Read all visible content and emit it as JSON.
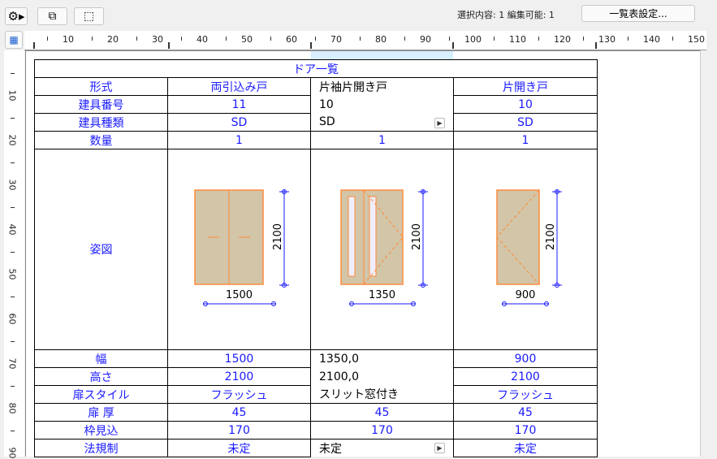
{
  "toolbar": {
    "status": "選択内容: 1  編集可能: 1",
    "settings_button": "一覧表設定..."
  },
  "ruler": {
    "h_labels": [
      "10",
      "20",
      "30",
      "40",
      "50",
      "60",
      "70",
      "80",
      "90",
      "100",
      "110",
      "120",
      "130",
      "140",
      "150"
    ],
    "v_labels": [
      "10",
      "20",
      "30",
      "40",
      "50",
      "60",
      "70",
      "80",
      "90"
    ]
  },
  "schedule": {
    "title": "ドア一覧",
    "rows": [
      {
        "label": "形式",
        "values": [
          "両引込み戸",
          "片袖片開き戸",
          "片開き戸"
        ]
      },
      {
        "label": "建具番号",
        "values": [
          "11",
          "10",
          "10"
        ]
      },
      {
        "label": "建具種類",
        "values": [
          "SD",
          "SD",
          "SD"
        ]
      },
      {
        "label": "数量",
        "values": [
          "1",
          "1",
          "1"
        ]
      },
      {
        "label": "姿図"
      },
      {
        "label": "幅",
        "values": [
          "1500",
          "1350,0",
          "900"
        ]
      },
      {
        "label": "高さ",
        "values": [
          "2100",
          "2100,0",
          "2100"
        ]
      },
      {
        "label": "扉スタイル",
        "values": [
          "フラッシュ",
          "スリット窓付き",
          "フラッシュ"
        ]
      },
      {
        "label": "扉 厚",
        "values": [
          "45",
          "45",
          "45"
        ]
      },
      {
        "label": "枠見込",
        "values": [
          "170",
          "170",
          "170"
        ]
      },
      {
        "label": "法規制",
        "values": [
          "未定",
          "未定",
          "未定"
        ]
      }
    ],
    "drawings": [
      {
        "width": "1500",
        "height": "2100"
      },
      {
        "width": "1350",
        "height": "2100"
      },
      {
        "width": "900",
        "height": "2100"
      }
    ]
  },
  "colors": {
    "accent": "#1a1aff",
    "door_fill": "#d3c5a8",
    "door_stroke": "#ff8c3a"
  }
}
